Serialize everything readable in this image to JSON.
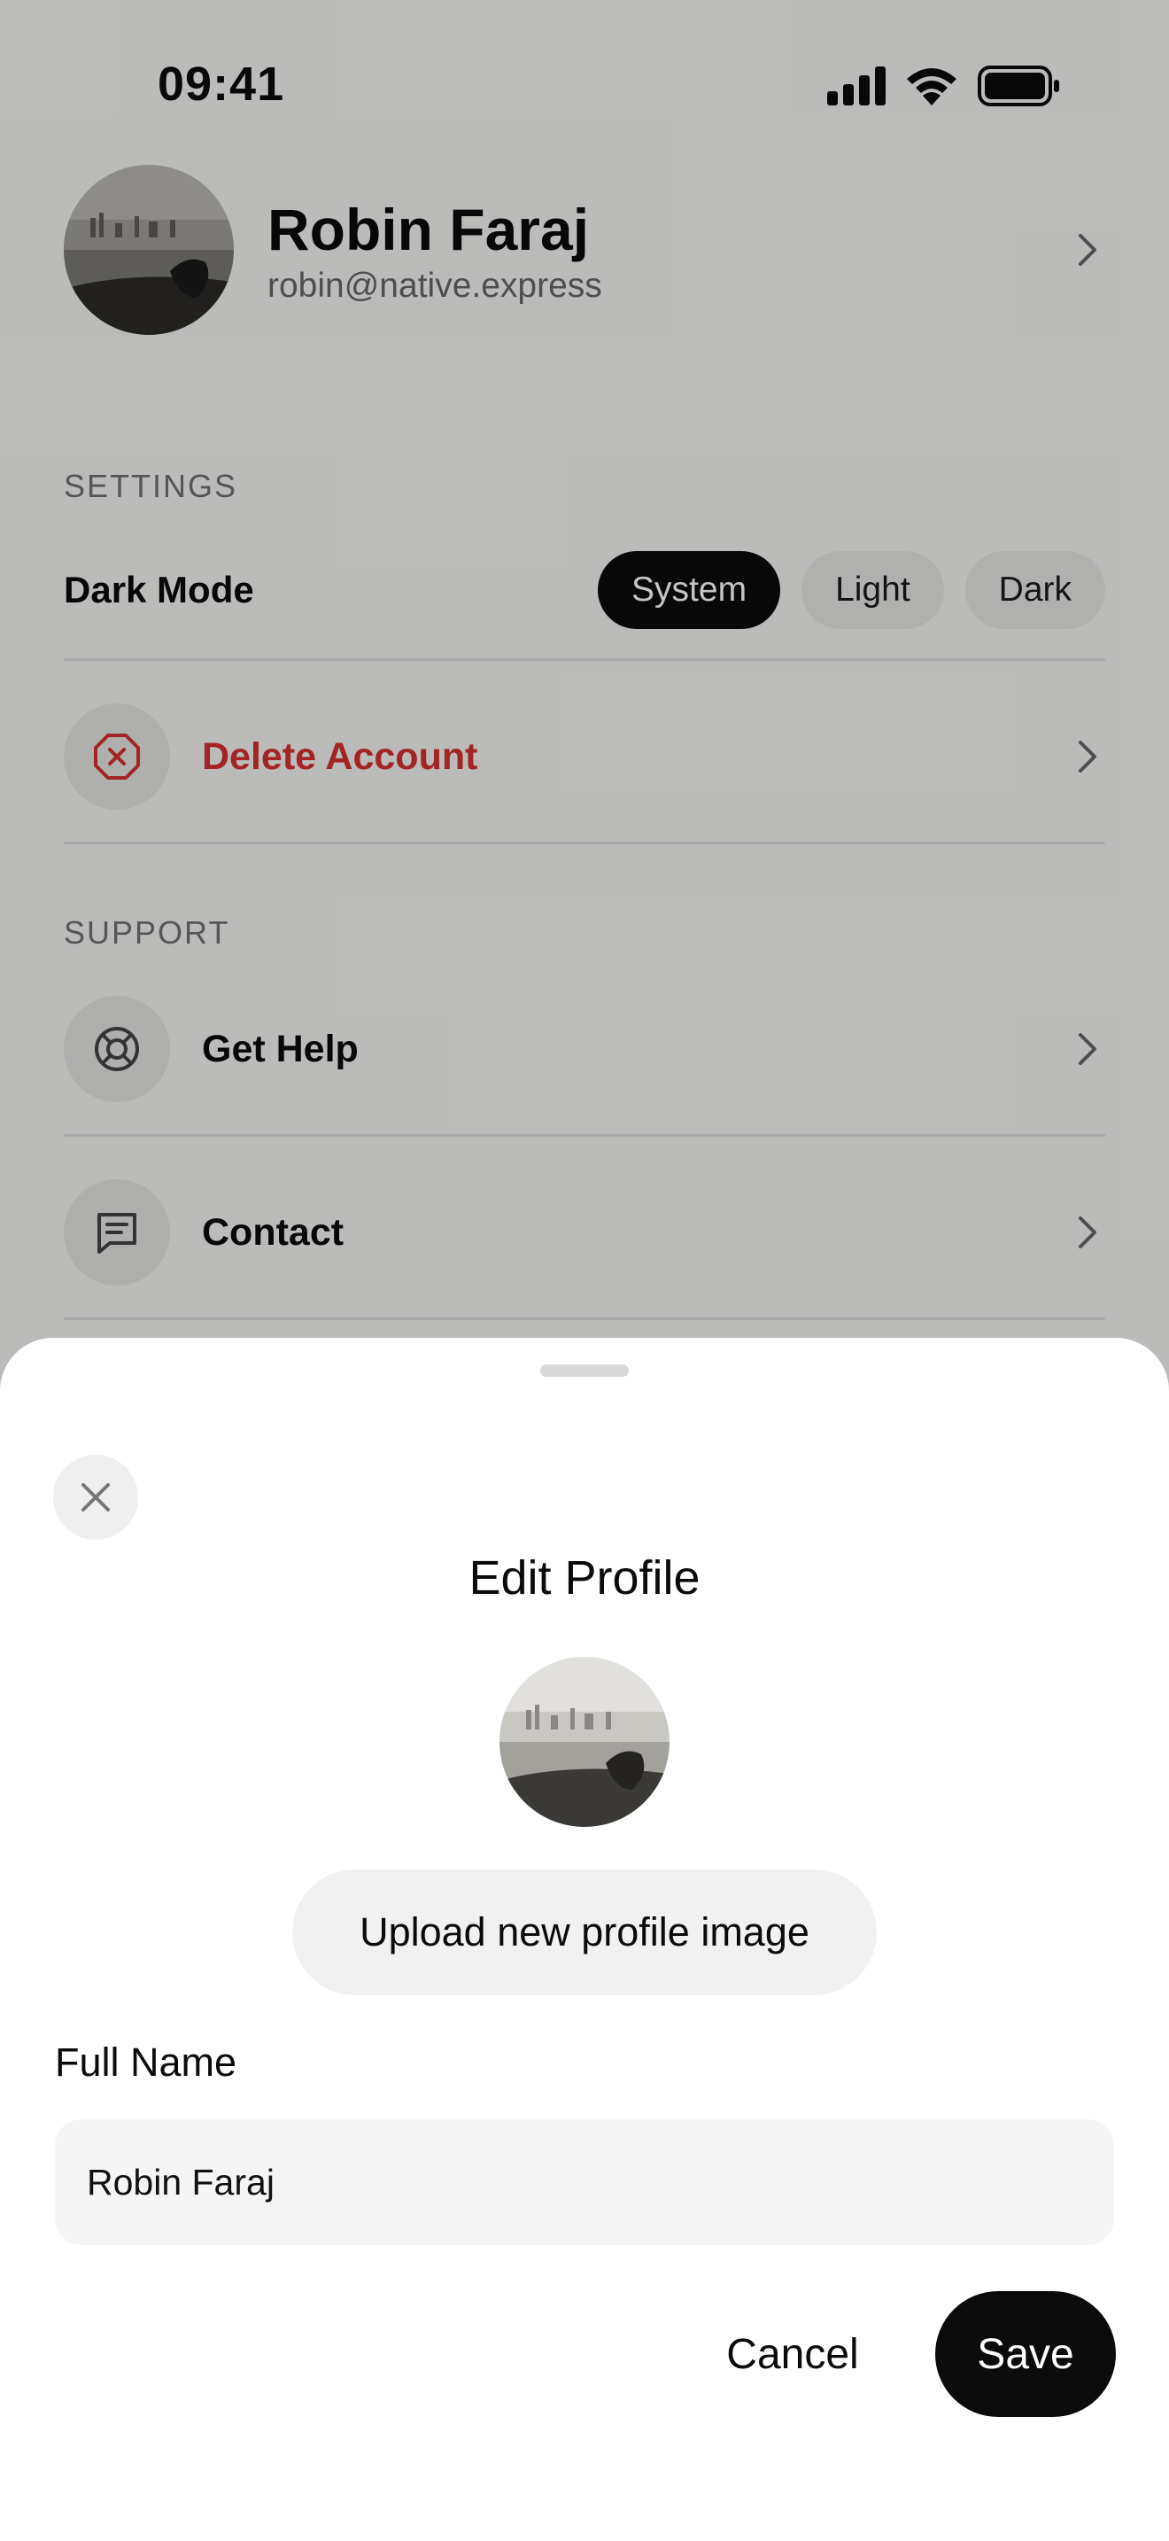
{
  "status_bar": {
    "time": "09:41"
  },
  "profile": {
    "name": "Robin Faraj",
    "email": "robin@native.express"
  },
  "settings": {
    "section_label": "SETTINGS",
    "dark_mode": {
      "label": "Dark Mode",
      "options": [
        "System",
        "Light",
        "Dark"
      ],
      "selected": "System"
    },
    "delete_account": {
      "label": "Delete Account",
      "icon": "x-octagon-icon",
      "color": "#d32f2f"
    }
  },
  "support": {
    "section_label": "SUPPORT",
    "items": [
      {
        "label": "Get Help",
        "icon": "lifebuoy-icon"
      },
      {
        "label": "Contact",
        "icon": "message-icon"
      }
    ]
  },
  "sheet": {
    "title": "Edit Profile",
    "upload_label": "Upload new profile image",
    "full_name_label": "Full Name",
    "full_name_value": "Robin Faraj",
    "cancel_label": "Cancel",
    "save_label": "Save"
  },
  "colors": {
    "accent": "#0b0b0b",
    "danger": "#d32f2f"
  }
}
